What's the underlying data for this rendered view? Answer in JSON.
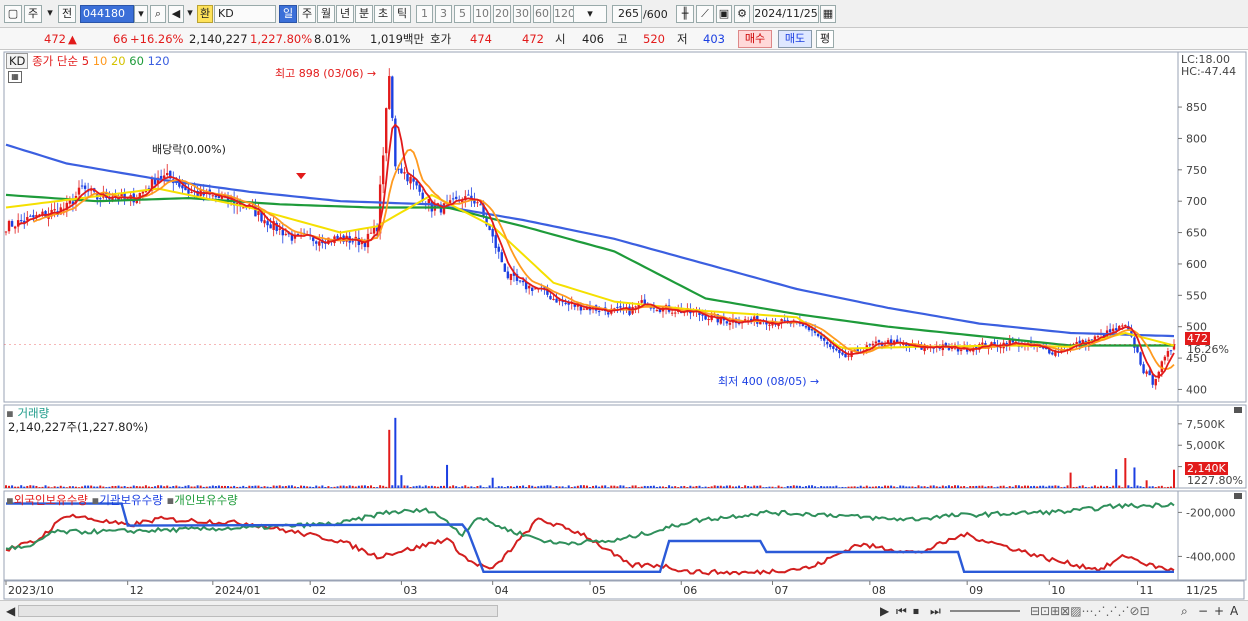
{
  "toolbar": {
    "period_label": "주",
    "prev_label": "전",
    "code": "044180",
    "exchange_badge": "환",
    "name": "KD",
    "timeframes": [
      "일",
      "주",
      "월",
      "년",
      "분",
      "초",
      "틱"
    ],
    "selected_timeframe": "일",
    "intervals": [
      "1",
      "3",
      "5",
      "10",
      "20",
      "30",
      "60",
      "120"
    ],
    "count": "265",
    "count_max": "/600",
    "date": "2024/11/25"
  },
  "quote": {
    "price": "472",
    "arrow": "▲",
    "change": "66",
    "change_pct": "+16.26%",
    "volume": "2,140,227",
    "volume_pct": "1,227.80%",
    "turnover_pct": "8.01%",
    "amount": "1,019백만",
    "bid_label": "호가",
    "ask": "474",
    "bid": "472",
    "open_label": "시",
    "open": "406",
    "high_label": "고",
    "high": "520",
    "low_label": "저",
    "low": "403",
    "buy_label": "매수",
    "sell_label": "매도",
    "eval_label": "평"
  },
  "colors": {
    "up": "#e21b1b",
    "down": "#1b3fe2",
    "ma5": "#e21b1b",
    "ma10": "#ff9a1f",
    "ma20": "#f5e000",
    "ma60": "#1e9b3a",
    "ma120": "#3b5fe0"
  },
  "icons": [
    "layout-icon",
    "search-icon",
    "speaker-icon",
    "settings-icon",
    "save-icon",
    "calendar-icon"
  ],
  "chart_data": [
    {
      "type": "candlestick",
      "legend": {
        "tag": "KD",
        "label": "종가 단순",
        "periods": [
          "5",
          "10",
          "20",
          "60",
          "120"
        ]
      },
      "lc_label": "LC:18.00",
      "hc_label": "HC:-47.44",
      "y_ticks": [
        850,
        800,
        750,
        700,
        650,
        600,
        550,
        500,
        450,
        400
      ],
      "ylim": [
        380,
        925
      ],
      "x_labels": [
        "2023/10",
        "12",
        "2024/01",
        "02",
        "03",
        "04",
        "05",
        "06",
        "07",
        "08",
        "09",
        "10",
        "11",
        "11/25"
      ],
      "last_price_tag": "472",
      "last_pct_tag": "16.26%",
      "annotations": {
        "high": "최고 898 (03/06)",
        "low": "최저 400 (08/05)",
        "dividend": "배당락(0.00%)"
      },
      "close_path": [
        [
          0,
          660
        ],
        [
          10,
          675
        ],
        [
          20,
          690
        ],
        [
          25,
          720
        ],
        [
          30,
          705
        ],
        [
          35,
          710
        ],
        [
          40,
          700
        ],
        [
          45,
          715
        ],
        [
          50,
          740
        ],
        [
          55,
          735
        ],
        [
          60,
          715
        ],
        [
          70,
          705
        ],
        [
          80,
          690
        ],
        [
          88,
          660
        ],
        [
          95,
          640
        ],
        [
          102,
          640
        ],
        [
          110,
          640
        ],
        [
          118,
          635
        ],
        [
          122,
          660
        ],
        [
          126,
          898
        ],
        [
          128,
          760
        ],
        [
          132,
          740
        ],
        [
          136,
          715
        ],
        [
          140,
          690
        ],
        [
          145,
          690
        ],
        [
          150,
          705
        ],
        [
          155,
          700
        ],
        [
          160,
          640
        ],
        [
          165,
          580
        ],
        [
          170,
          565
        ],
        [
          175,
          560
        ],
        [
          180,
          545
        ],
        [
          185,
          535
        ],
        [
          192,
          530
        ],
        [
          198,
          525
        ],
        [
          205,
          525
        ],
        [
          210,
          540
        ],
        [
          215,
          530
        ],
        [
          222,
          525
        ],
        [
          228,
          520
        ],
        [
          235,
          510
        ],
        [
          242,
          510
        ],
        [
          250,
          510
        ],
        [
          258,
          505
        ],
        [
          265,
          495
        ],
        [
          270,
          470
        ],
        [
          275,
          450
        ],
        [
          280,
          460
        ],
        [
          285,
          470
        ],
        [
          290,
          475
        ],
        [
          295,
          470
        ],
        [
          300,
          465
        ],
        [
          305,
          470
        ],
        [
          310,
          465
        ],
        [
          315,
          465
        ],
        [
          320,
          470
        ],
        [
          325,
          470
        ],
        [
          330,
          475
        ],
        [
          335,
          470
        ],
        [
          340,
          465
        ],
        [
          345,
          460
        ],
        [
          350,
          470
        ],
        [
          355,
          475
        ],
        [
          360,
          485
        ],
        [
          365,
          495
        ],
        [
          368,
          500
        ],
        [
          371,
          470
        ],
        [
          374,
          430
        ],
        [
          377,
          412
        ],
        [
          380,
          440
        ],
        [
          384,
          472
        ]
      ],
      "ma_paths": {
        "ma20": [
          [
            0,
            690
          ],
          [
            50,
            720
          ],
          [
            80,
            690
          ],
          [
            110,
            650
          ],
          [
            122,
            660
          ],
          [
            140,
            710
          ],
          [
            160,
            660
          ],
          [
            180,
            570
          ],
          [
            200,
            540
          ],
          [
            230,
            525
          ],
          [
            260,
            515
          ],
          [
            275,
            465
          ],
          [
            300,
            468
          ],
          [
            330,
            470
          ],
          [
            350,
            468
          ],
          [
            368,
            490
          ],
          [
            384,
            470
          ]
        ],
        "ma60": [
          [
            0,
            710
          ],
          [
            30,
            700
          ],
          [
            60,
            705
          ],
          [
            90,
            695
          ],
          [
            120,
            690
          ],
          [
            145,
            690
          ],
          [
            170,
            660
          ],
          [
            200,
            620
          ],
          [
            230,
            545
          ],
          [
            260,
            520
          ],
          [
            290,
            500
          ],
          [
            320,
            485
          ],
          [
            350,
            470
          ],
          [
            384,
            470
          ]
        ],
        "ma120": [
          [
            0,
            790
          ],
          [
            20,
            760
          ],
          [
            50,
            735
          ],
          [
            80,
            715
          ],
          [
            110,
            700
          ],
          [
            140,
            695
          ],
          [
            170,
            670
          ],
          [
            200,
            640
          ],
          [
            230,
            600
          ],
          [
            260,
            560
          ],
          [
            290,
            530
          ],
          [
            320,
            505
          ],
          [
            350,
            490
          ],
          [
            384,
            485
          ]
        ]
      }
    },
    {
      "type": "bar",
      "title": "거래량",
      "value_label": "2,140,227주(1,227.80%)",
      "y_ticks": [
        "7,500K",
        "5,000K",
        "2,500K"
      ],
      "ylim": [
        0,
        9000
      ],
      "last_value_tag": "2,140K",
      "last_pct_tag": "1227.80%",
      "spikes": [
        [
          126,
          6800
        ],
        [
          128,
          8200
        ],
        [
          130,
          1500
        ],
        [
          145,
          2700
        ],
        [
          160,
          1200
        ],
        [
          350,
          1800
        ],
        [
          365,
          2200
        ],
        [
          368,
          3500
        ],
        [
          371,
          2400
        ],
        [
          375,
          900
        ],
        [
          384,
          2140
        ]
      ]
    },
    {
      "type": "line",
      "legend": [
        "외국인보유수량",
        "기관보유수량",
        "개인보유수량"
      ],
      "y_ticks": [
        "-200,000",
        "-400,000"
      ]
    }
  ],
  "bottom": {
    "play_icons": [
      "▶",
      "⏮",
      "⏹",
      "⏭"
    ]
  }
}
